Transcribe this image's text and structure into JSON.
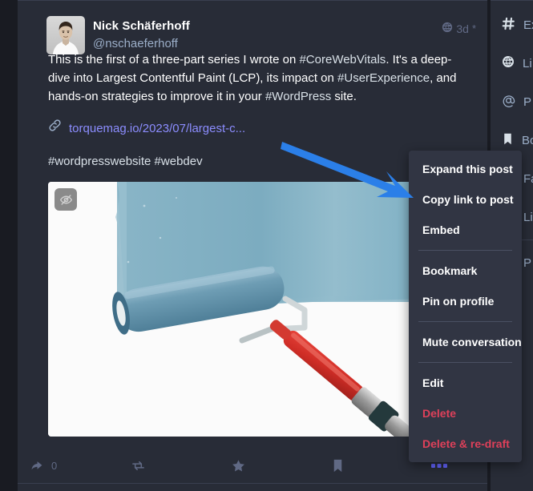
{
  "post": {
    "display_name": "Nick Schäferhoff",
    "acct": "@nschaeferhoff",
    "timestamp": "3d",
    "edited_marker": "*",
    "visibility_icon": "globe-icon",
    "text_part_1": "This is the first of a three-part series I wrote on ",
    "hashtag_1": "#CoreWebVitals",
    "text_part_2": ". It's a deep-dive into Largest Contentful Paint (LCP), its impact on ",
    "hashtag_2": "#UserExperience",
    "text_part_3": ", and hands-on strategies to improve it in your ",
    "hashtag_3": "#WordPress",
    "text_part_4": " site.",
    "link_text": "torquemag.io/2023/07/largest-c...",
    "link_icon": "link-icon",
    "tags_line": "#wordpresswebsite #webdev",
    "media_toggle_icon": "eye-slash-icon",
    "media_alt": "A blue paint roller painting a wall light blue next to a red-handled paint brush"
  },
  "actions": [
    {
      "name": "reply",
      "icon": "reply-icon",
      "count": "0"
    },
    {
      "name": "boost",
      "icon": "boost-icon",
      "count": ""
    },
    {
      "name": "favourite",
      "icon": "star-icon",
      "count": ""
    },
    {
      "name": "bookmark",
      "icon": "bookmark-icon",
      "count": ""
    },
    {
      "name": "more",
      "icon": "ellipsis-icon",
      "count": ""
    }
  ],
  "menu": {
    "groups": [
      {
        "items": [
          {
            "label": "Expand this post",
            "danger": false
          },
          {
            "label": "Copy link to post",
            "danger": false
          },
          {
            "label": "Embed",
            "danger": false
          }
        ]
      },
      {
        "items": [
          {
            "label": "Bookmark",
            "danger": false
          },
          {
            "label": "Pin on profile",
            "danger": false
          }
        ]
      },
      {
        "items": [
          {
            "label": "Mute conversation",
            "danger": false
          }
        ]
      },
      {
        "items": [
          {
            "label": "Edit",
            "danger": false
          },
          {
            "label": "Delete",
            "danger": true
          },
          {
            "label": "Delete & re-draft",
            "danger": true
          }
        ]
      }
    ]
  },
  "sidebar": {
    "items": [
      {
        "label": "Ex",
        "icon": "hash-icon"
      },
      {
        "label": "Li",
        "icon": "globe-icon"
      },
      {
        "label": "P",
        "icon": "at-icon"
      },
      {
        "label": "Bo",
        "icon": "bookmark-icon"
      },
      {
        "label": "Fa",
        "icon": "star-icon"
      },
      {
        "label": "Li",
        "icon": "list-icon"
      },
      {
        "label": "P",
        "icon": "gear-icon"
      }
    ]
  },
  "colors": {
    "app_background": "#191b22",
    "column_background": "#282c37",
    "menu_background": "#313543",
    "accent_link": "#8c8dff",
    "accent_more": "#6364ff",
    "danger": "#df405a",
    "muted_text": "#9baec8",
    "annotation_arrow": "#2b7fe8"
  }
}
